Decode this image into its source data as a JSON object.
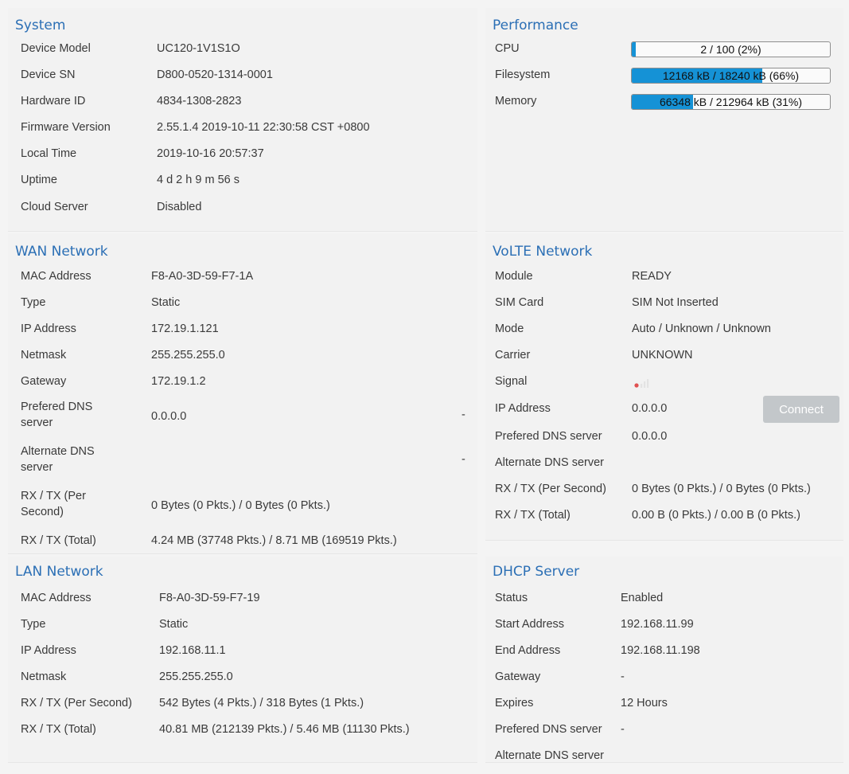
{
  "system": {
    "title": "System",
    "rows": [
      {
        "label": "Device Model",
        "value": "UC120-1V1S1O"
      },
      {
        "label": "Device SN",
        "value": "D800-0520-1314-0001"
      },
      {
        "label": "Hardware ID",
        "value": "4834-1308-2823"
      },
      {
        "label": "Firmware Version",
        "value": "2.55.1.4 2019-10-11 22:30:58 CST +0800"
      },
      {
        "label": "Local Time",
        "value": "2019-10-16 20:57:37"
      },
      {
        "label": "Uptime",
        "value": "4 d 2 h 9 m 56 s"
      },
      {
        "label": "Cloud Server",
        "value": "Disabled"
      }
    ]
  },
  "performance": {
    "title": "Performance",
    "rows": [
      {
        "label": "CPU",
        "text": "2 / 100 (2%)",
        "percent": 2
      },
      {
        "label": "Filesystem",
        "text": "12168 kB / 18240 kB (66%)",
        "percent": 66
      },
      {
        "label": "Memory",
        "text": "66348 kB / 212964 kB (31%)",
        "percent": 31
      }
    ]
  },
  "wan": {
    "title": "WAN Network",
    "rows": [
      {
        "label": "MAC Address",
        "value": "F8-A0-3D-59-F7-1A"
      },
      {
        "label": "Type",
        "value": "Static"
      },
      {
        "label": "IP Address",
        "value": "172.19.1.121"
      },
      {
        "label": "Netmask",
        "value": "255.255.255.0"
      },
      {
        "label": "Gateway",
        "value": "172.19.1.2"
      },
      {
        "label": "Prefered DNS server",
        "value": "0.0.0.0",
        "extra": "-"
      },
      {
        "label": "Alternate DNS server",
        "value": "",
        "extra": "-"
      },
      {
        "label": "RX / TX (Per Second)",
        "value": "0 Bytes (0 Pkts.) / 0 Bytes (0 Pkts.)"
      },
      {
        "label": "RX / TX (Total)",
        "value": "4.24 MB (37748 Pkts.) / 8.71 MB (169519 Pkts.)"
      }
    ]
  },
  "volte": {
    "title": "VoLTE Network",
    "rows": [
      {
        "label": "Module",
        "value": "READY"
      },
      {
        "label": "SIM Card",
        "value": "SIM Not Inserted"
      },
      {
        "label": "Mode",
        "value": "Auto / Unknown / Unknown"
      },
      {
        "label": "Carrier",
        "value": "UNKNOWN"
      },
      {
        "label": "Signal",
        "value": ""
      },
      {
        "label": "IP Address",
        "value": "0.0.0.0"
      },
      {
        "label": "Prefered DNS server",
        "value": "0.0.0.0"
      },
      {
        "label": "Alternate DNS server",
        "value": ""
      },
      {
        "label": "RX / TX (Per Second)",
        "value": "0 Bytes (0 Pkts.) / 0 Bytes (0 Pkts.)"
      },
      {
        "label": "RX / TX (Total)",
        "value": "0.00 B (0 Pkts.) / 0.00 B (0 Pkts.)"
      }
    ],
    "connect_label": "Connect",
    "signal_icon": "signal-strength-icon"
  },
  "lan": {
    "title": "LAN Network",
    "rows": [
      {
        "label": "MAC Address",
        "value": "F8-A0-3D-59-F7-19"
      },
      {
        "label": "Type",
        "value": "Static"
      },
      {
        "label": "IP Address",
        "value": "192.168.11.1"
      },
      {
        "label": "Netmask",
        "value": "255.255.255.0"
      },
      {
        "label": "RX / TX (Per Second)",
        "value": "542 Bytes (4 Pkts.) / 318 Bytes (1 Pkts.)"
      },
      {
        "label": "RX / TX (Total)",
        "value": "40.81 MB (212139 Pkts.) / 5.46 MB (11130 Pkts.)"
      }
    ]
  },
  "dhcp": {
    "title": "DHCP Server",
    "rows": [
      {
        "label": "Status",
        "value": "Enabled"
      },
      {
        "label": "Start Address",
        "value": "192.168.11.99"
      },
      {
        "label": "End Address",
        "value": "192.168.11.198"
      },
      {
        "label": "Gateway",
        "value": "-"
      },
      {
        "label": "Expires",
        "value": "12 Hours"
      },
      {
        "label": "Prefered DNS server",
        "value": "-"
      },
      {
        "label": "Alternate DNS server",
        "value": ""
      }
    ]
  },
  "colors": {
    "title": "#2b6fb5",
    "bar_fill": "#1592d6",
    "button": "#c3c7ca",
    "signal_dot": "#e05050"
  }
}
